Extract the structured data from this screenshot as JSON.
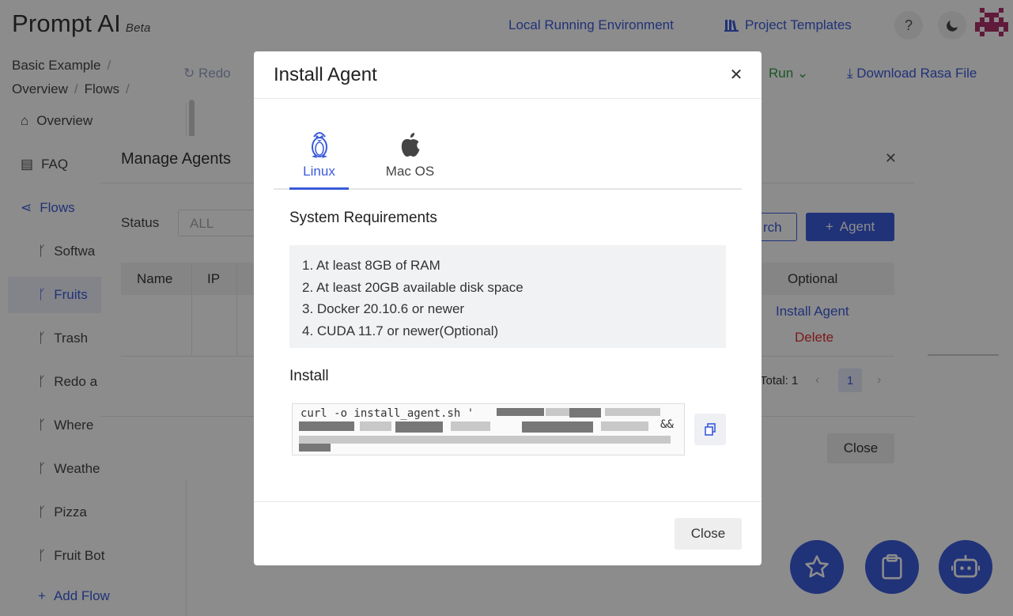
{
  "app": {
    "title": "Prompt AI",
    "badge": "Beta",
    "top_links": {
      "local_env": "Local Running Environment",
      "templates": "Project Templates"
    },
    "help_icon": "?",
    "breadcrumb": [
      "Basic Example",
      "Overview",
      "Flows"
    ],
    "toolbar": {
      "redo": "Redo",
      "run": "Run",
      "download": "Download Rasa File"
    },
    "sidebar": {
      "items": [
        {
          "label": "Overview",
          "icon": "home-icon"
        },
        {
          "label": "FAQ",
          "icon": "book-icon"
        },
        {
          "label": "Flows",
          "icon": "flow-icon"
        }
      ],
      "flows": [
        "Softwa",
        "Fruits",
        "Trash",
        "Redo a",
        "Where",
        "Weathe",
        "Pizza",
        "Fruit Bot"
      ],
      "add_flow": "Add Flow"
    },
    "colors": {
      "accent": "#3b5bdb",
      "success": "#2f9e44",
      "danger": "#e03131"
    }
  },
  "manage": {
    "title": "Manage Agents",
    "status_label": "Status",
    "status_value": "ALL",
    "search_label": "rch",
    "add_label": "Agent",
    "columns": {
      "name": "Name",
      "ip": "IP",
      "optional": "Optional"
    },
    "row_actions": {
      "install": "Install Agent",
      "delete": "Delete"
    },
    "total": "Total: 1",
    "page": "1",
    "close": "Close"
  },
  "install": {
    "title": "Install Agent",
    "tabs": [
      {
        "label": "Linux",
        "icon": "linux-icon"
      },
      {
        "label": "Mac OS",
        "icon": "apple-icon"
      }
    ],
    "requirements_title": "System Requirements",
    "requirements": [
      "1. At least 8GB of RAM",
      "2. At least 20GB available disk space",
      "3. Docker 20.10.6 or newer",
      "4. CUDA 11.7 or newer(Optional)"
    ],
    "install_title": "Install",
    "command": "curl -o install_agent.sh '",
    "command_tail": "&&",
    "close": "Close"
  }
}
